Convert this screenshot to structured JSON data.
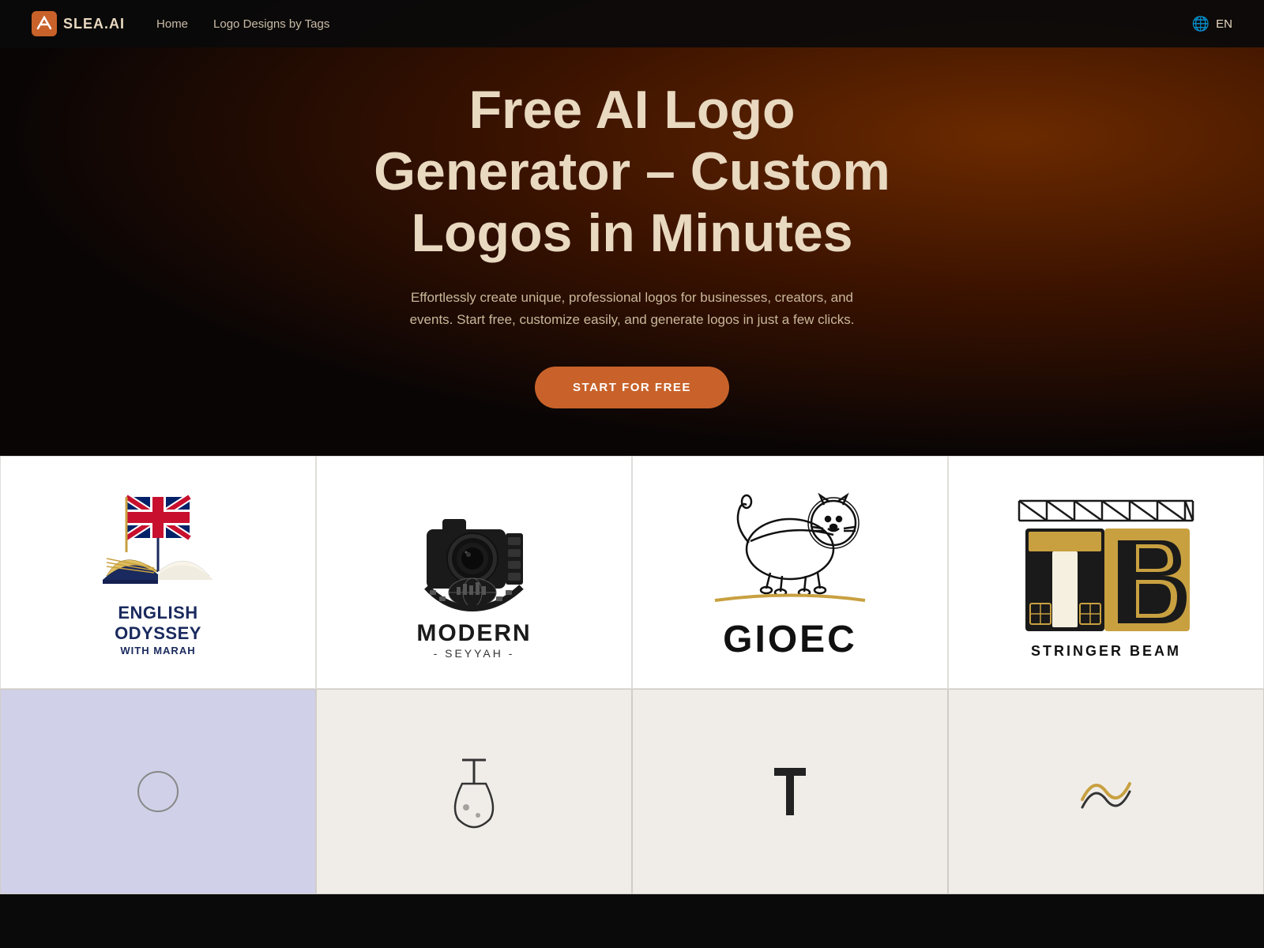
{
  "nav": {
    "logo_text": "SLEA.AI",
    "links": [
      {
        "label": "Home",
        "href": "#"
      },
      {
        "label": "Logo Designs by Tags",
        "href": "#"
      }
    ],
    "lang_label": "EN"
  },
  "hero": {
    "title": "Free AI Logo Generator – Custom Logos in Minutes",
    "subtitle": "Effortlessly create unique, professional logos for businesses, creators, and events. Start free, customize easily, and generate logos in just a few clicks.",
    "cta_label": "START FOR FREE"
  },
  "logo_grid": {
    "cards": [
      {
        "id": "english-odyssey",
        "alt": "English Odyssey with Marah logo"
      },
      {
        "id": "modern-seyyah",
        "alt": "Modern Seyyah logo"
      },
      {
        "id": "gioec",
        "alt": "GIOEC lion logo"
      },
      {
        "id": "stringer-beam",
        "alt": "Stringer Beam TB logo"
      }
    ]
  },
  "bottom_row": {
    "cards": [
      {
        "id": "bottom-1",
        "bg": "#d0d0e0"
      },
      {
        "id": "bottom-2",
        "bg": "#f0ede8"
      },
      {
        "id": "bottom-3",
        "bg": "#f0ede8"
      },
      {
        "id": "bottom-4",
        "bg": "#f0ede8"
      }
    ]
  }
}
